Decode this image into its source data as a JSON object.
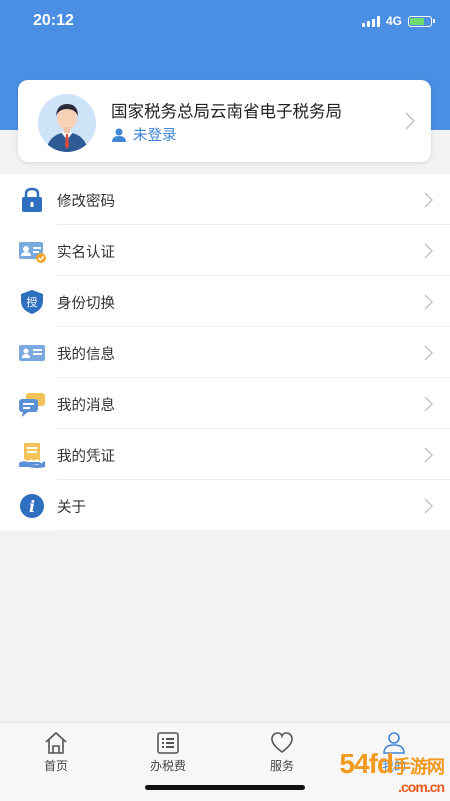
{
  "status": {
    "time": "20:12",
    "network": "4G"
  },
  "profile": {
    "title": "国家税务总局云南省电子税务局",
    "login_status": "未登录"
  },
  "menu": [
    {
      "label": "修改密码",
      "icon": "lock-icon"
    },
    {
      "label": "实名认证",
      "icon": "id-card-verified-icon"
    },
    {
      "label": "身份切换",
      "icon": "authorize-shield-icon"
    },
    {
      "label": "我的信息",
      "icon": "user-info-card-icon"
    },
    {
      "label": "我的消息",
      "icon": "message-bubble-icon"
    },
    {
      "label": "我的凭证",
      "icon": "voucher-receipt-icon"
    },
    {
      "label": "关于",
      "icon": "info-icon"
    }
  ],
  "tabs": [
    {
      "label": "首页",
      "icon": "home-icon"
    },
    {
      "label": "办税费",
      "icon": "list-document-icon"
    },
    {
      "label": "服务",
      "icon": "heart-icon"
    },
    {
      "label": "我的",
      "icon": "user-icon"
    }
  ],
  "watermark": {
    "main": "54fd",
    "sub": "手游网",
    "domain": ".com.cn"
  },
  "colors": {
    "header": "#4a8fe3",
    "accent": "#3f86d6"
  }
}
